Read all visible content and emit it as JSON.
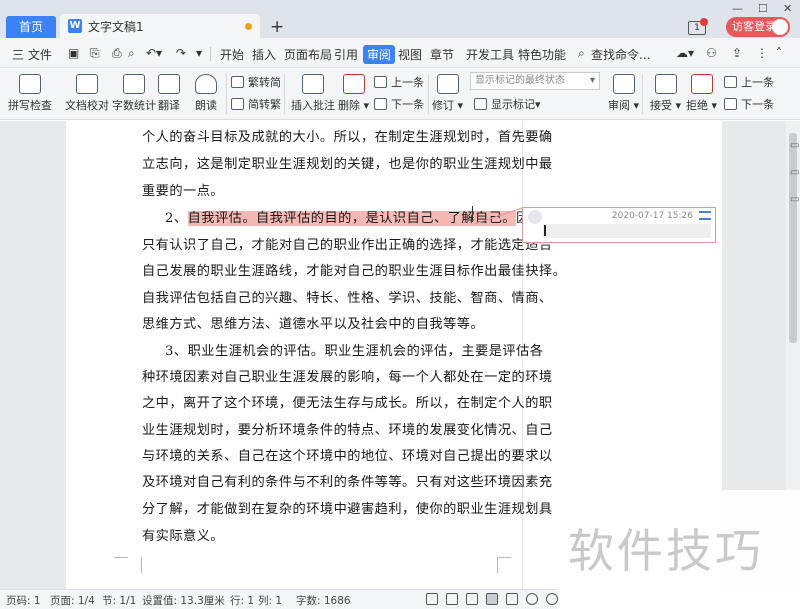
{
  "titlebar": {
    "home_tab": "首页",
    "doc_tab": "文字文稿1",
    "doc_icon": "W",
    "new_tab": "+",
    "page_count": "1",
    "login_button": "访客登录"
  },
  "menubar": {
    "file": "三 文件",
    "items": [
      "开始",
      "插入",
      "页面布局",
      "引用",
      "审阅",
      "视图",
      "章节",
      "开发工具",
      "特色功能"
    ],
    "active": "审阅",
    "search": "查找命令..."
  },
  "ribbon": {
    "spell_check": "拼写检查",
    "doc_proof": "文档校对",
    "word_count": "字数统计",
    "translate": "翻译",
    "read_aloud": "朗读",
    "to_traditional": "繁转简",
    "to_simplified": "简转繁",
    "insert_comment": "插入批注",
    "delete": "删除",
    "prev": "上一条",
    "next": "下一条",
    "revise": "修订",
    "display_state": "显示标记的最终状态",
    "show_marks": "显示标记",
    "review": "审阅",
    "accept": "接受",
    "reject": "拒绝",
    "prev2": "上一条",
    "next2": "下一条"
  },
  "document": {
    "lines": [
      "个人的奋斗目标及成就的大小。所以，在制定生涯规划时，首先要确",
      "立志向，这是制定职业生涯规划的关键，也是你的职业生涯规划中最",
      "重要的一点。",
      "只有认识了自己，才能对自己的职业作出正确的选择，才能选定适合",
      "自己发展的职业生涯路线，才能对自己的职业生涯目标作出最佳抉择。",
      "自我评估包括自己的兴趣、特长、性格、学识、技能、智商、情商、",
      "思维方式、思维方法、道德水平以及社会中的自我等等。",
      "3、职业生涯机会的评估。职业生涯机会的评估，主要是评估各",
      "种环境因素对自己职业生涯发展的影响，每一个人都处在一定的环境",
      "之中，离开了这个环境，便无法生存与成长。所以，在制定个人的职",
      "业生涯规划时，要分析环境条件的特点、环境的发展变化情况、自己",
      "与环境的关系、自己在这个环境中的地位、环境对自己提出的要求以",
      "及环境对自己有利的条件与不利的条件等等。只有对这些环境因素充",
      "分了解，才能做到在复杂的环境中避害趋利，使你的职业生涯规划具",
      "有实际意义。"
    ],
    "para2_prefix": "2、",
    "para2_highlight": "自我评估。自我评估的目的，是认识自己、了解自己。",
    "para2_suffix": "因为"
  },
  "comment": {
    "date": "2020-07-17 15:26"
  },
  "statusbar": {
    "page_code": "页码: 1",
    "pages": "页面: 1/4",
    "section": "节: 1/1",
    "setting": "设置值: 13.3厘米",
    "row": "行: 1",
    "col": "列: 1",
    "words": "字数: 1686"
  },
  "watermark": "软件技巧",
  "colors": {
    "accent": "#3b82f6",
    "highlight": "#f4b8b5",
    "login": "#e9575b"
  }
}
